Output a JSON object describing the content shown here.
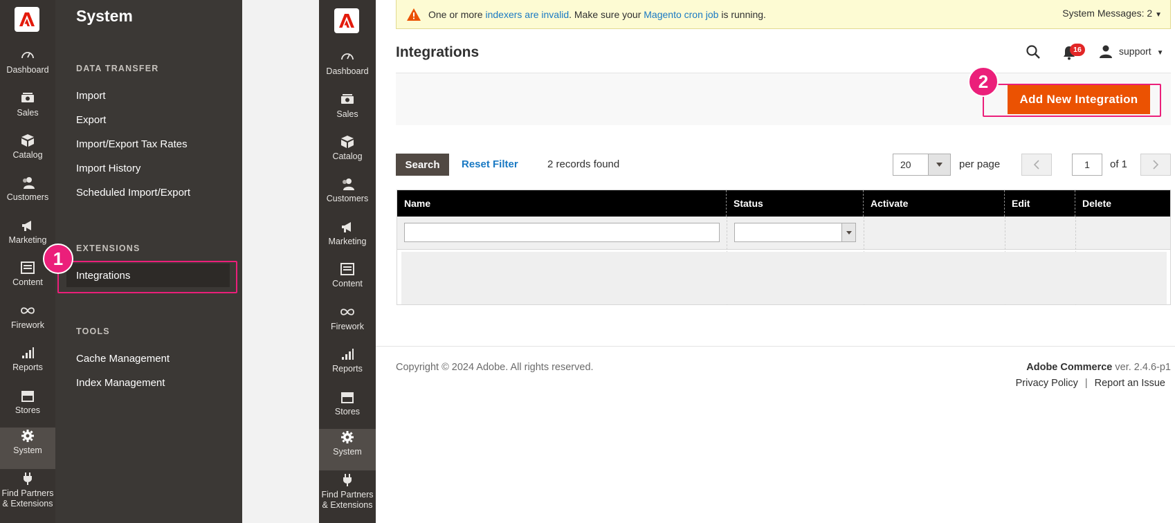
{
  "nav_items": [
    {
      "key": "dashboard",
      "label": "Dashboard",
      "icon": "dashboard-icon"
    },
    {
      "key": "sales",
      "label": "Sales",
      "icon": "sales-icon"
    },
    {
      "key": "catalog",
      "label": "Catalog",
      "icon": "catalog-icon"
    },
    {
      "key": "customers",
      "label": "Customers",
      "icon": "customers-icon"
    },
    {
      "key": "marketing",
      "label": "Marketing",
      "icon": "marketing-icon"
    },
    {
      "key": "content",
      "label": "Content",
      "icon": "content-icon"
    },
    {
      "key": "firework",
      "label": "Firework",
      "icon": "firework-icon"
    },
    {
      "key": "reports",
      "label": "Reports",
      "icon": "reports-icon"
    },
    {
      "key": "stores",
      "label": "Stores",
      "icon": "stores-icon"
    },
    {
      "key": "system",
      "label": "System",
      "icon": "gear-icon"
    },
    {
      "key": "partners",
      "label_line1": "Find Partners",
      "label_line2": "& Extensions",
      "icon": "plug-icon"
    }
  ],
  "flyout": {
    "title": "System",
    "data_transfer": "DATA TRANSFER",
    "import": "Import",
    "export": "Export",
    "tax_rates": "Import/Export Tax Rates",
    "history": "Import History",
    "scheduled": "Scheduled Import/Export",
    "extensions": "EXTENSIONS",
    "integrations": "Integrations",
    "tools": "TOOLS",
    "cache": "Cache Management",
    "index": "Index Management"
  },
  "steps": {
    "one": "1",
    "two": "2"
  },
  "sys_msg": {
    "prefix": "One or more ",
    "link1": "indexers are invalid",
    "middle": ". Make sure your ",
    "link2": "Magento cron job",
    "suffix": " is running.",
    "right": "System Messages: 2"
  },
  "header": {
    "title": "Integrations",
    "notifications": "16",
    "user": "support"
  },
  "actions": {
    "add": "Add New Integration"
  },
  "toolbar": {
    "search": "Search",
    "reset": "Reset Filter",
    "records": "2 records found",
    "per_page_value": "20",
    "per_page": "per page",
    "page": "1",
    "of": "of 1"
  },
  "grid": {
    "columns": [
      "Name",
      "Status",
      "Activate",
      "Edit",
      "Delete"
    ]
  },
  "footer": {
    "copyright": "Copyright © 2024 Adobe. All rights reserved.",
    "brand": "Adobe Commerce",
    "version": " ver. 2.4.6-p1",
    "privacy": "Privacy Policy",
    "sep": "|",
    "report": "Report an Issue"
  },
  "colors": {
    "accent": "#eb5202",
    "highlight": "#eb1f7a",
    "nav_bg": "#373330"
  }
}
